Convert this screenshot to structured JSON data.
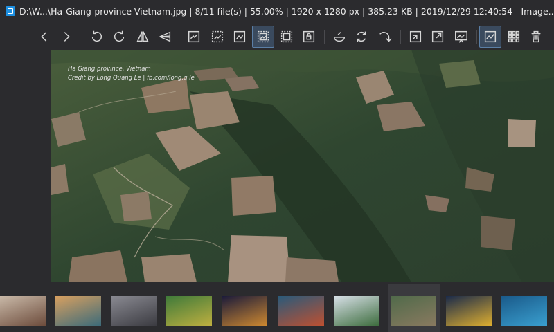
{
  "titlebar": {
    "text": "D:\\W...\\Ha-Giang-province-Vietnam.jpg  |  8/11 file(s)  |  55.00%  |  1920 x 1280 px  |  385.23 KB  |  2019/12/29 12:40:54  -  Image..."
  },
  "image": {
    "caption_line1": "Ha Giang province, Vietnam",
    "caption_line2": "Credit by Long Quang Le | fb.com/long.q.le"
  },
  "toolbar": {
    "buttons": [
      {
        "name": "previous-icon"
      },
      {
        "name": "next-icon"
      },
      {
        "name": "rotate-left-icon"
      },
      {
        "name": "rotate-right-icon"
      },
      {
        "name": "flip-horizontal-icon"
      },
      {
        "name": "flip-vertical-icon"
      },
      {
        "name": "auto-zoom-icon"
      },
      {
        "name": "lock-zoom-icon"
      },
      {
        "name": "scale-to-width-icon"
      },
      {
        "name": "scale-to-fit-icon"
      },
      {
        "name": "scale-to-fill-icon"
      },
      {
        "name": "lock-ratio-icon"
      },
      {
        "name": "color-picker-icon"
      },
      {
        "name": "refresh-icon"
      },
      {
        "name": "goto-icon"
      },
      {
        "name": "open-folder-icon"
      },
      {
        "name": "fullscreen-icon"
      },
      {
        "name": "slideshow-icon"
      },
      {
        "name": "thumbnail-bar-icon"
      },
      {
        "name": "grid-view-icon"
      },
      {
        "name": "delete-icon"
      }
    ],
    "accent": "#5b7fa6"
  },
  "thumbnails": [
    {
      "name": "thumb-1",
      "colors": [
        "#c9b9a8",
        "#6b4a3a"
      ]
    },
    {
      "name": "thumb-2",
      "colors": [
        "#d8a060",
        "#3a6a7a"
      ]
    },
    {
      "name": "thumb-3",
      "colors": [
        "#8a8a92",
        "#3a3a40"
      ]
    },
    {
      "name": "thumb-4",
      "colors": [
        "#3f7a3a",
        "#c0b040"
      ]
    },
    {
      "name": "thumb-5",
      "colors": [
        "#1a1a3a",
        "#d08a30"
      ]
    },
    {
      "name": "thumb-6",
      "colors": [
        "#2a5a7a",
        "#c05030"
      ]
    },
    {
      "name": "thumb-7",
      "colors": [
        "#d8e0e8",
        "#3a6a3a"
      ]
    },
    {
      "name": "thumb-8",
      "colors": [
        "#506a4a",
        "#8a7a60"
      ],
      "current": true
    },
    {
      "name": "thumb-9",
      "colors": [
        "#1a2a4a",
        "#e0b030"
      ]
    },
    {
      "name": "thumb-10",
      "colors": [
        "#1a5a8a",
        "#3aa0d0"
      ]
    }
  ]
}
